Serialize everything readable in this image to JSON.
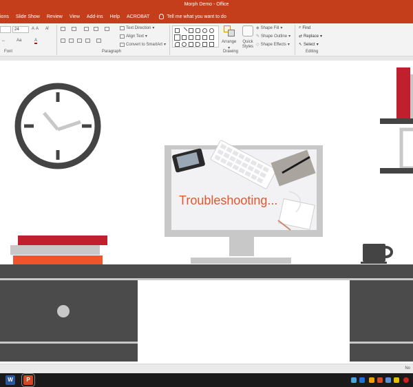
{
  "window": {
    "title": "Morph Demo - Office"
  },
  "tabs": [
    "ions",
    "Slide Show",
    "Review",
    "View",
    "Add-ins",
    "Help",
    "ACROBAT"
  ],
  "tell_me": "Tell me what you want to do",
  "ribbon": {
    "font_size": "24",
    "groups": {
      "font": "Font",
      "paragraph": "Paragraph",
      "drawing": "Drawing",
      "editing": "Editing"
    },
    "text_direction": "Text Direction",
    "align_text": "Align Text",
    "convert_smartart": "Convert to SmartArt",
    "arrange": "Arrange",
    "quick_styles": "Quick Styles",
    "shape_fill": "Shape Fill",
    "shape_outline": "Shape Outline",
    "shape_effects": "Shape Effects",
    "find": "Find",
    "replace": "Replace",
    "select": "Select"
  },
  "slide": {
    "monitor_text": "Troubleshooting..."
  },
  "colors": {
    "accent": "#c43e1c",
    "dark": "#444444",
    "red": "#c0202e",
    "orange": "#f0542a",
    "gray": "#c8c8c8"
  },
  "status": {
    "notes": "No"
  }
}
